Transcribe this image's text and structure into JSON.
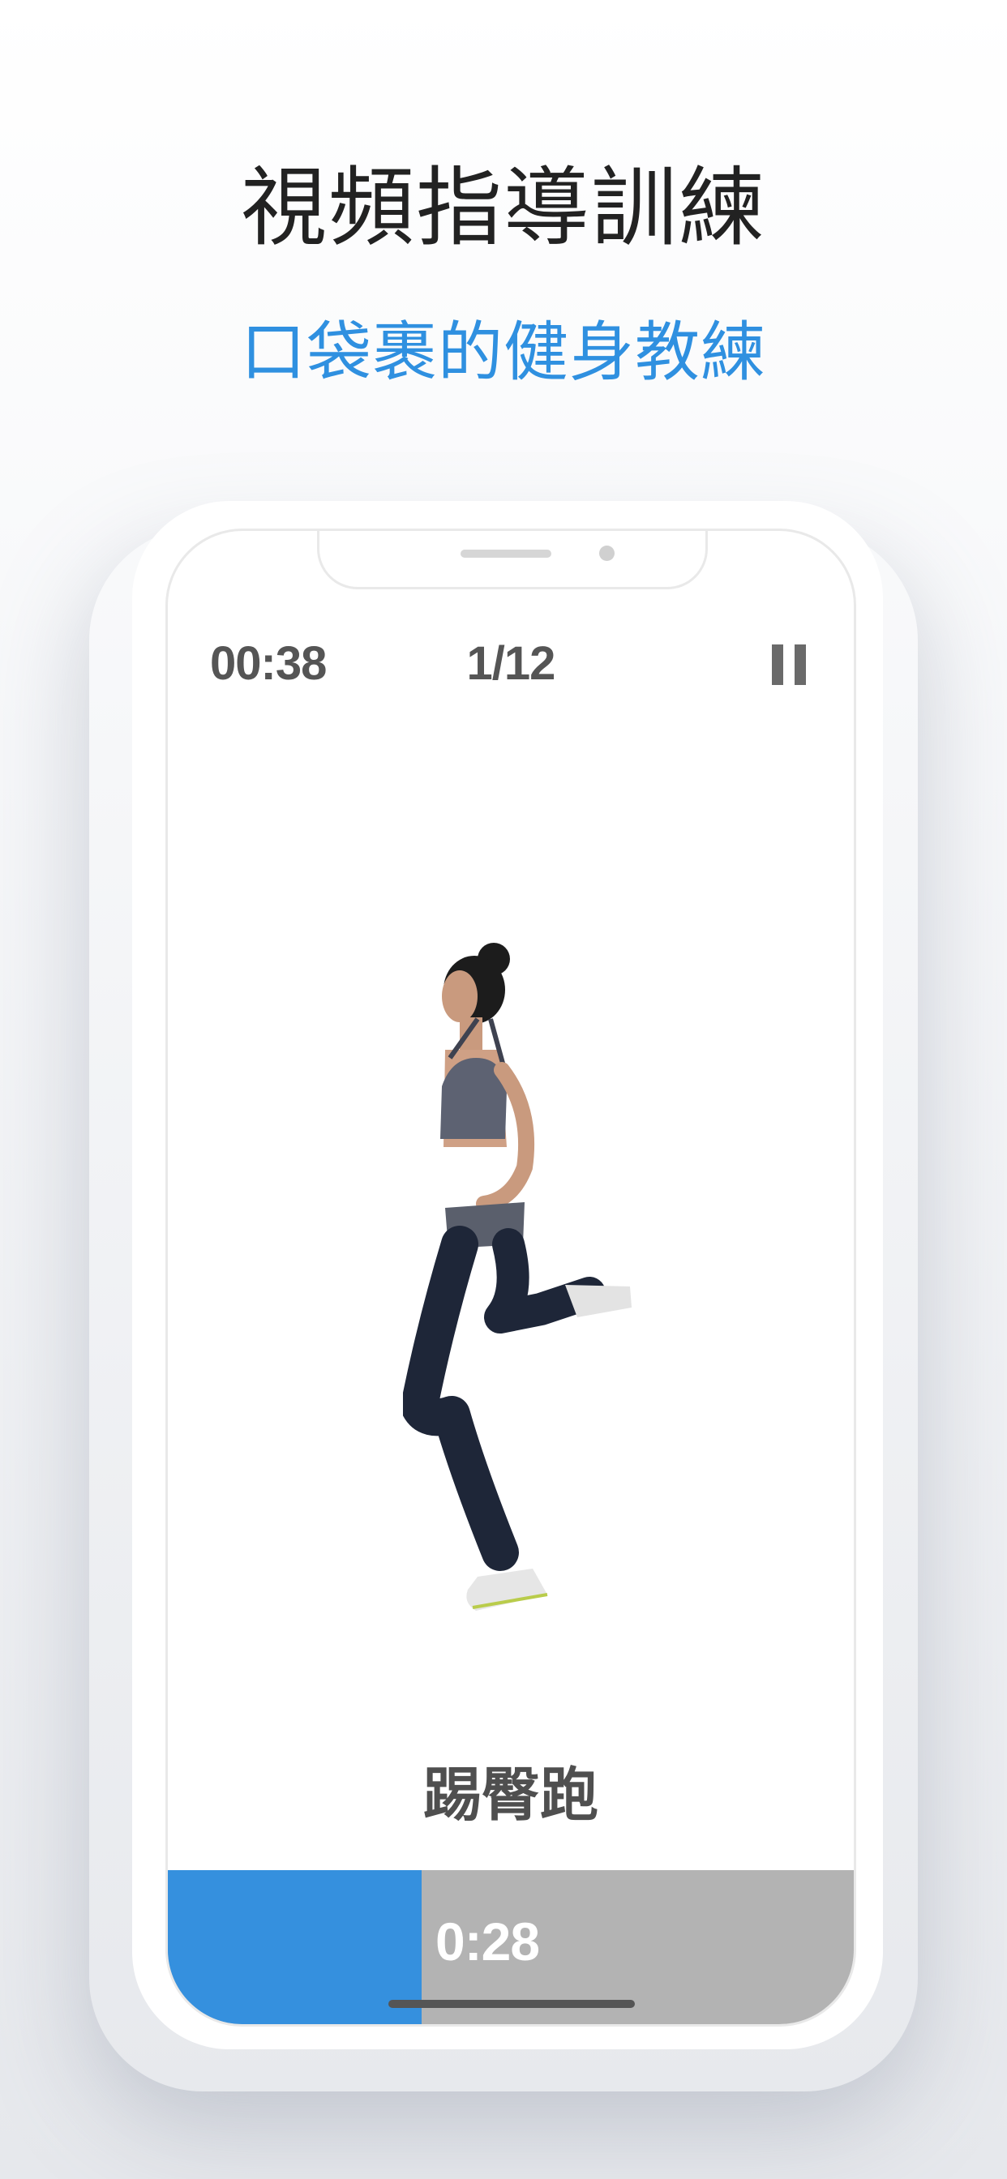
{
  "headline": "視頻指導訓練",
  "subheadline": "口袋裹的健身教練",
  "workout": {
    "elapsed_time": "00:38",
    "exercise_counter": "1/12",
    "exercise_name": "踢臀跑",
    "remaining_time": "0:28",
    "progress_fraction": 0.37
  },
  "icons": {
    "pause": "pause-icon"
  },
  "colors": {
    "accent": "#3590de",
    "progress_track": "#b3b3b3",
    "headline": "#222222",
    "subheadline": "#2f90e0"
  }
}
